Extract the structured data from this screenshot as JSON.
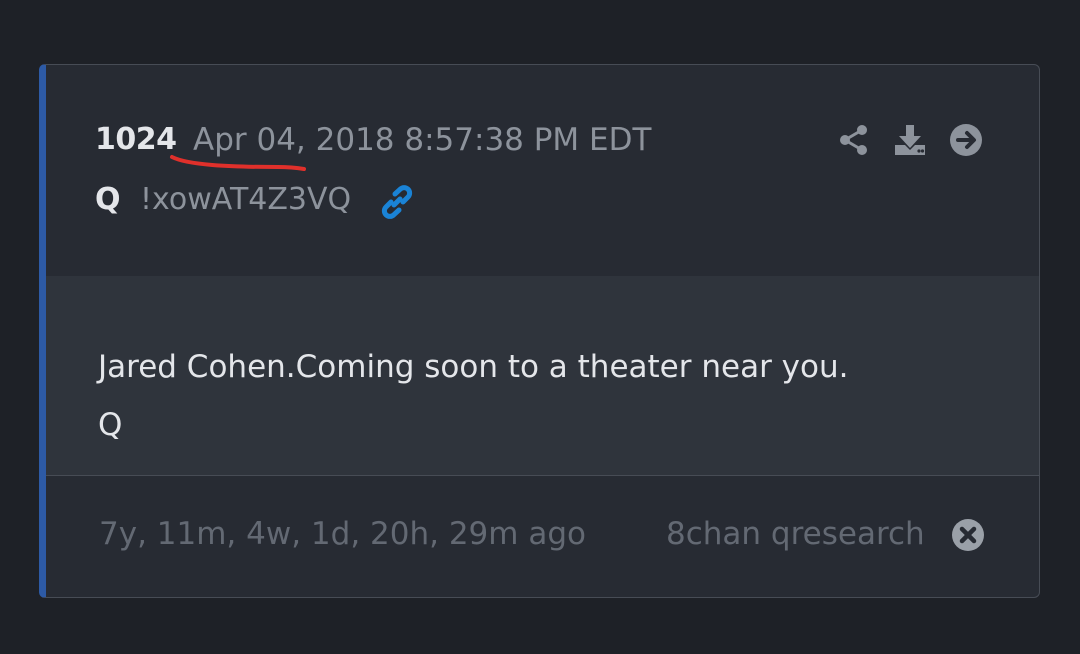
{
  "post": {
    "number": "1024",
    "timestamp": "Apr 04, 2018 8:57:38 PM EDT",
    "author": "Q",
    "tripcode": "!xowAT4Z3VQ",
    "lines": [
      "Jared Cohen.Coming soon to a theater near you.",
      "Q"
    ],
    "age": "7y, 11m, 4w, 1d, 20h, 29m ago",
    "source": "8chan qresearch"
  },
  "icons": {
    "share": "share-icon",
    "download": "download-icon",
    "goto": "arrow-circle-right-icon",
    "link": "link-icon",
    "close": "close-circle-icon"
  },
  "colors": {
    "accent_border": "#2d5aa5",
    "link": "#1a83d6",
    "annotation": "#e0302b"
  }
}
